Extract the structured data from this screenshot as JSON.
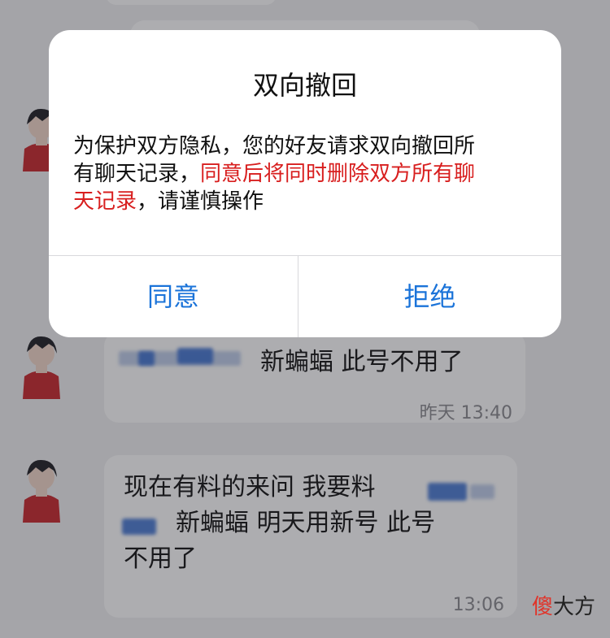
{
  "dialog": {
    "title": "双向撤回",
    "body_line1": "为保护双方隐私，您的好友请求双向撤回所",
    "body_line2_normal": "有聊天记录，",
    "body_line2_red": "同意后将同时删除双方所有聊",
    "body_line3_red": "天记录",
    "body_line3_normal": "，请谨慎操作",
    "agree_label": "同意",
    "reject_label": "拒绝",
    "accent_color": "#1a73d9",
    "warning_color": "#d81e1e"
  },
  "messages": [
    {
      "text_line1": "新蝙蝠  此号不用了",
      "time": "昨天 13:40"
    },
    {
      "text_line1": "现在有料的来问  我要料",
      "text_line2": "新蝙蝠  明天用新号   此号",
      "text_line3": "不用了",
      "time": "13:06"
    }
  ],
  "watermark": {
    "accent": "傻",
    "rest": "大方"
  }
}
